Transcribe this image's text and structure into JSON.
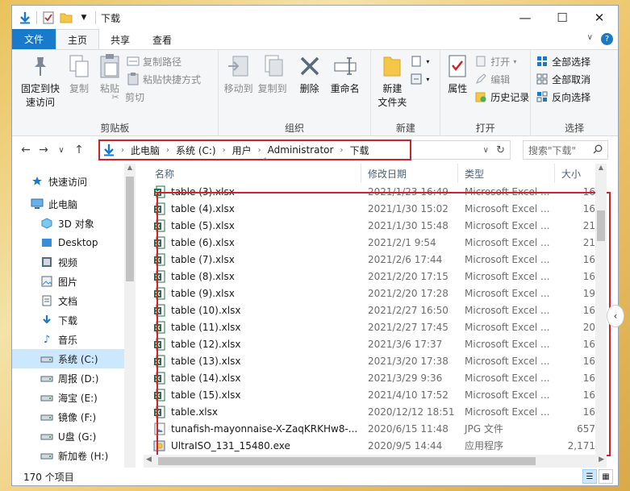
{
  "window": {
    "title": "下载"
  },
  "title_controls": {
    "minimize": "—",
    "maximize": "☐",
    "close": "✕"
  },
  "tabs": {
    "file": "文件",
    "home": "主页",
    "share": "共享",
    "view": "查看"
  },
  "ribbon": {
    "clipboard": {
      "label": "剪贴板",
      "pin": "固定到快\n速访问",
      "copy": "复制",
      "paste": "粘贴",
      "copy_path": "复制路径",
      "paste_shortcut": "粘贴快捷方式",
      "cut": "剪切"
    },
    "organize": {
      "label": "组织",
      "move_to": "移动到",
      "copy_to": "复制到",
      "delete": "删除",
      "rename": "重命名"
    },
    "new": {
      "label": "新建",
      "new_folder": "新建\n文件夹"
    },
    "open": {
      "label": "打开",
      "properties": "属性",
      "open": "打开",
      "edit": "编辑",
      "history": "历史记录"
    },
    "select": {
      "label": "选择",
      "select_all": "全部选择",
      "select_none": "全部取消",
      "invert": "反向选择"
    }
  },
  "address": {
    "crumbs": [
      "此电脑",
      "系统 (C:)",
      "用户",
      "Administrator",
      "下载"
    ],
    "search_placeholder": "搜索\"下载\""
  },
  "nav": {
    "items": [
      {
        "label": "快速访问",
        "icon": "star-icon"
      },
      {
        "label": "此电脑",
        "icon": "computer-icon"
      },
      {
        "label": "3D 对象",
        "icon": "cube-icon"
      },
      {
        "label": "Desktop",
        "icon": "desktop-icon"
      },
      {
        "label": "视频",
        "icon": "video-icon"
      },
      {
        "label": "图片",
        "icon": "picture-icon"
      },
      {
        "label": "文档",
        "icon": "document-icon"
      },
      {
        "label": "下载",
        "icon": "download-icon"
      },
      {
        "label": "音乐",
        "icon": "music-icon"
      },
      {
        "label": "系统 (C:)",
        "icon": "drive-icon"
      },
      {
        "label": "周报 (D:)",
        "icon": "drive-icon"
      },
      {
        "label": "海宝 (E:)",
        "icon": "drive-icon"
      },
      {
        "label": "镜像 (F:)",
        "icon": "drive-icon"
      },
      {
        "label": "U盘 (G:)",
        "icon": "drive-icon"
      },
      {
        "label": "新加卷 (H:)",
        "icon": "drive-icon"
      }
    ]
  },
  "columns": {
    "name": "名称",
    "date": "修改日期",
    "type": "类型",
    "size": "大小"
  },
  "files": [
    {
      "name": "table (3).xlsx",
      "date": "2021/1/23 16:49",
      "type": "Microsoft Excel ...",
      "size": "16",
      "icon": "excel-icon"
    },
    {
      "name": "table (4).xlsx",
      "date": "2021/1/30 15:02",
      "type": "Microsoft Excel ...",
      "size": "16",
      "icon": "excel-icon"
    },
    {
      "name": "table (5).xlsx",
      "date": "2021/1/30 15:48",
      "type": "Microsoft Excel ...",
      "size": "21",
      "icon": "excel-icon"
    },
    {
      "name": "table (6).xlsx",
      "date": "2021/2/1 9:54",
      "type": "Microsoft Excel ...",
      "size": "21",
      "icon": "excel-icon"
    },
    {
      "name": "table (7).xlsx",
      "date": "2021/2/6 17:44",
      "type": "Microsoft Excel ...",
      "size": "16",
      "icon": "excel-icon"
    },
    {
      "name": "table (8).xlsx",
      "date": "2021/2/20 17:15",
      "type": "Microsoft Excel ...",
      "size": "16",
      "icon": "excel-icon"
    },
    {
      "name": "table (9).xlsx",
      "date": "2021/2/20 17:28",
      "type": "Microsoft Excel ...",
      "size": "19",
      "icon": "excel-icon"
    },
    {
      "name": "table (10).xlsx",
      "date": "2021/2/27 16:50",
      "type": "Microsoft Excel ...",
      "size": "16",
      "icon": "excel-icon"
    },
    {
      "name": "table (11).xlsx",
      "date": "2021/2/27 17:45",
      "type": "Microsoft Excel ...",
      "size": "20",
      "icon": "excel-icon"
    },
    {
      "name": "table (12).xlsx",
      "date": "2021/3/6 17:37",
      "type": "Microsoft Excel ...",
      "size": "16",
      "icon": "excel-icon"
    },
    {
      "name": "table (13).xlsx",
      "date": "2021/3/20 17:38",
      "type": "Microsoft Excel ...",
      "size": "16",
      "icon": "excel-icon"
    },
    {
      "name": "table (14).xlsx",
      "date": "2021/3/29 9:36",
      "type": "Microsoft Excel ...",
      "size": "16",
      "icon": "excel-icon"
    },
    {
      "name": "table (15).xlsx",
      "date": "2021/4/10 17:52",
      "type": "Microsoft Excel ...",
      "size": "16",
      "icon": "excel-icon"
    },
    {
      "name": "table.xlsx",
      "date": "2020/12/12 18:51",
      "type": "Microsoft Excel ...",
      "size": "16",
      "icon": "excel-icon"
    },
    {
      "name": "tunafish-mayonnaise-X-ZaqKRKHw8-...",
      "date": "2020/6/15 11:48",
      "type": "JPG 文件",
      "size": "657",
      "icon": "jpg-icon"
    },
    {
      "name": "UltraISO_131_15480.exe",
      "date": "2020/9/5 14:44",
      "type": "应用程序",
      "size": "2,171",
      "icon": "exe-icon"
    }
  ],
  "status": {
    "count": "170 个项目"
  },
  "colors": {
    "accent": "#1979ca",
    "highlight": "#d4202c",
    "excel": "#1d7044",
    "selected": "#cce8ff"
  }
}
